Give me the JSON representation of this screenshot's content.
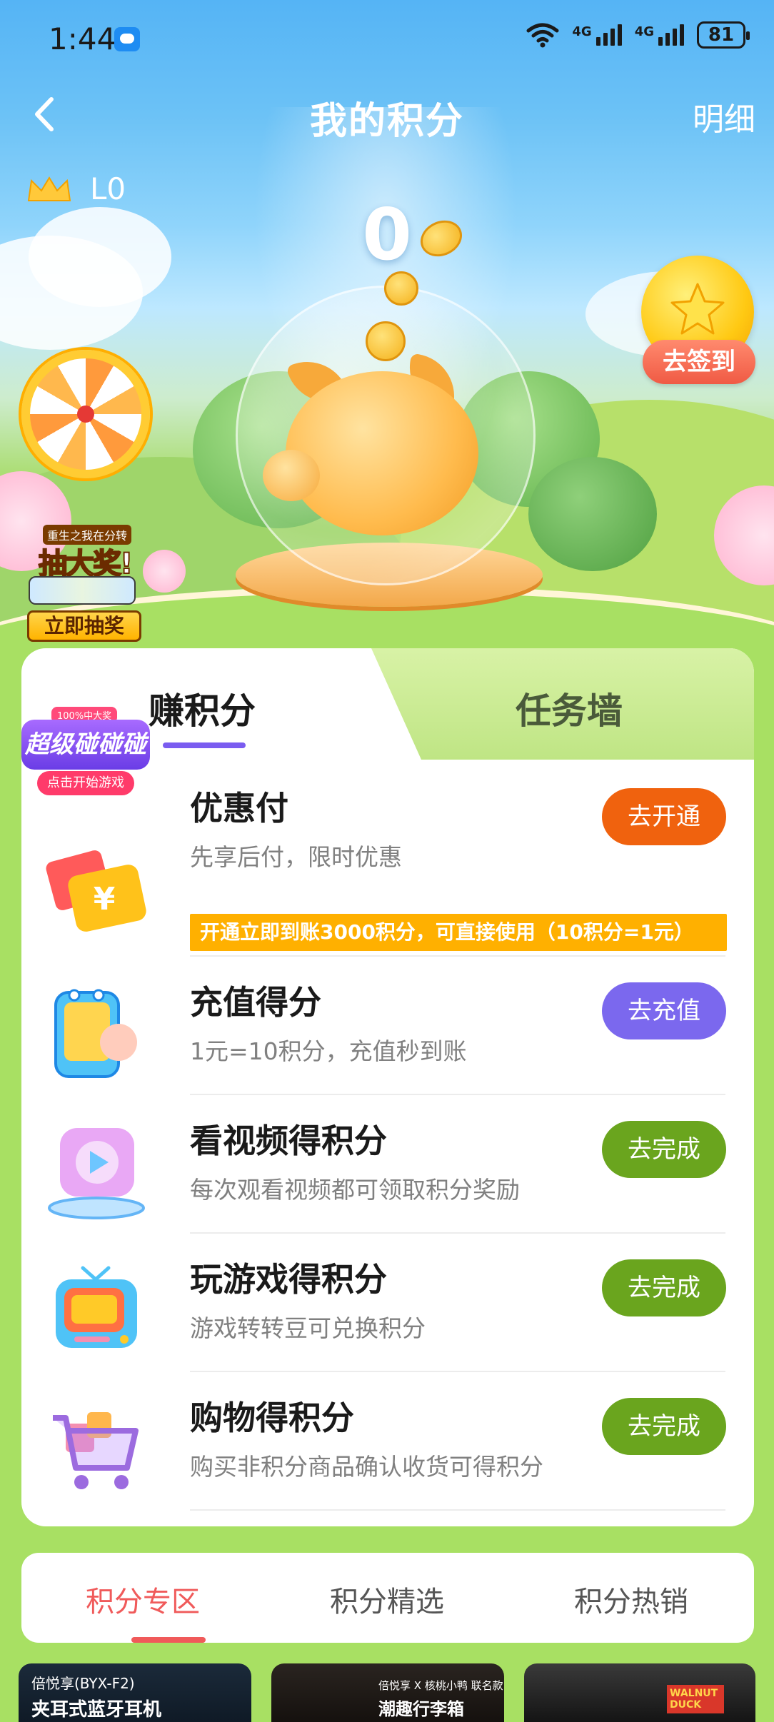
{
  "status_bar": {
    "time": "1:44",
    "signal_1_label": "4G",
    "signal_2_label": "4G",
    "battery": "81"
  },
  "nav": {
    "title": "我的积分",
    "detail_label": "明细"
  },
  "hero": {
    "level": "L0",
    "points": "0",
    "sign_in_label": "去签到",
    "lottery_top": "重生之我在分转",
    "lottery_big": "抽大奖!",
    "lottery_button": "立即抽奖"
  },
  "tabs": {
    "earn": "赚积分",
    "task_wall": "任务墙"
  },
  "game_badge": {
    "top": "100%中大奖",
    "main": "超级碰碰碰",
    "sub": "点击开始游戏"
  },
  "tasks": [
    {
      "title": "优惠付",
      "desc": "先享后付，限时优惠",
      "tag": "开通立即到账3000积分，可直接使用（10积分=1元）",
      "button": "去开通",
      "button_color": "#f0620e",
      "icon": "coupon-icon"
    },
    {
      "title": "充值得分",
      "desc": "1元=10积分，充值秒到账",
      "button": "去充值",
      "button_color": "#7b68ee",
      "icon": "phone-recharge-icon"
    },
    {
      "title": "看视频得积分",
      "desc": "每次观看视频都可领取积分奖励",
      "button": "去完成",
      "button_color": "#6aa51e",
      "icon": "video-play-icon"
    },
    {
      "title": "玩游戏得积分",
      "desc": "游戏转转豆可兑换积分",
      "button": "去完成",
      "button_color": "#6aa51e",
      "icon": "tv-game-icon"
    },
    {
      "title": "购物得积分",
      "desc": "购买非积分商品确认收货可得积分",
      "button": "去完成",
      "button_color": "#6aa51e",
      "icon": "shopping-cart-icon"
    }
  ],
  "mall": {
    "tabs": [
      "积分专区",
      "积分精选",
      "积分热销"
    ],
    "active_tab": "积分专区",
    "products": [
      {
        "brand": "倍悦享(BYX-F2)",
        "name": "夹耳式蓝牙耳机"
      },
      {
        "brand": "倍悦享 X 核桃小鸭 联名款",
        "name": "潮趣行李箱"
      },
      {
        "brand": "WALNUT DUCK",
        "name": ""
      }
    ]
  },
  "colors": {
    "sky_top": "#55b4f5",
    "page_green": "#a8e063",
    "accent_purple": "#7a5cf0",
    "accent_red": "#f05a5a",
    "promo_yellow": "#ffb000"
  }
}
